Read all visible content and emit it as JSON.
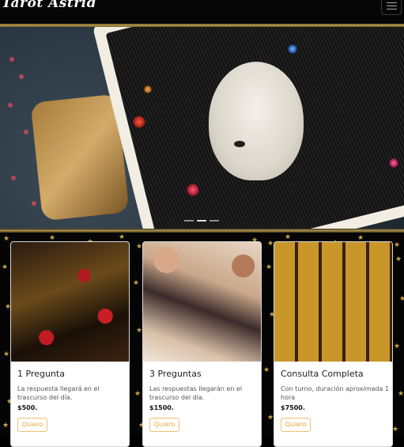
{
  "navbar": {
    "brand": "Tarot Astrid",
    "menu_icon": "hamburger-icon"
  },
  "hero": {
    "image_icon": "owl-tarot-card-photo",
    "slide_count": 3
  },
  "products": [
    {
      "title": "1 Pregunta",
      "description": "La respuesta llegará en el trascurso del día.",
      "price": "$500.",
      "button": "Quiero",
      "image_icon": "tarot-cards-roses-photo"
    },
    {
      "title": "3 Preguntas",
      "description": "Las respuestas llegarán en el trascurso del día.",
      "price": "$1500.",
      "button": "Quiero",
      "image_icon": "tarot-cards-flowers-photo"
    },
    {
      "title": "Consulta Completa",
      "description": "Con turno, duración aproximada 1 hora",
      "price": "$7500.",
      "button": "Quiero",
      "image_icon": "tarot-cards-spread-photo"
    }
  ],
  "colors": {
    "accent": "#e5a53b",
    "navbar_bg": "#060606",
    "star_gold": "#c9a54a"
  }
}
